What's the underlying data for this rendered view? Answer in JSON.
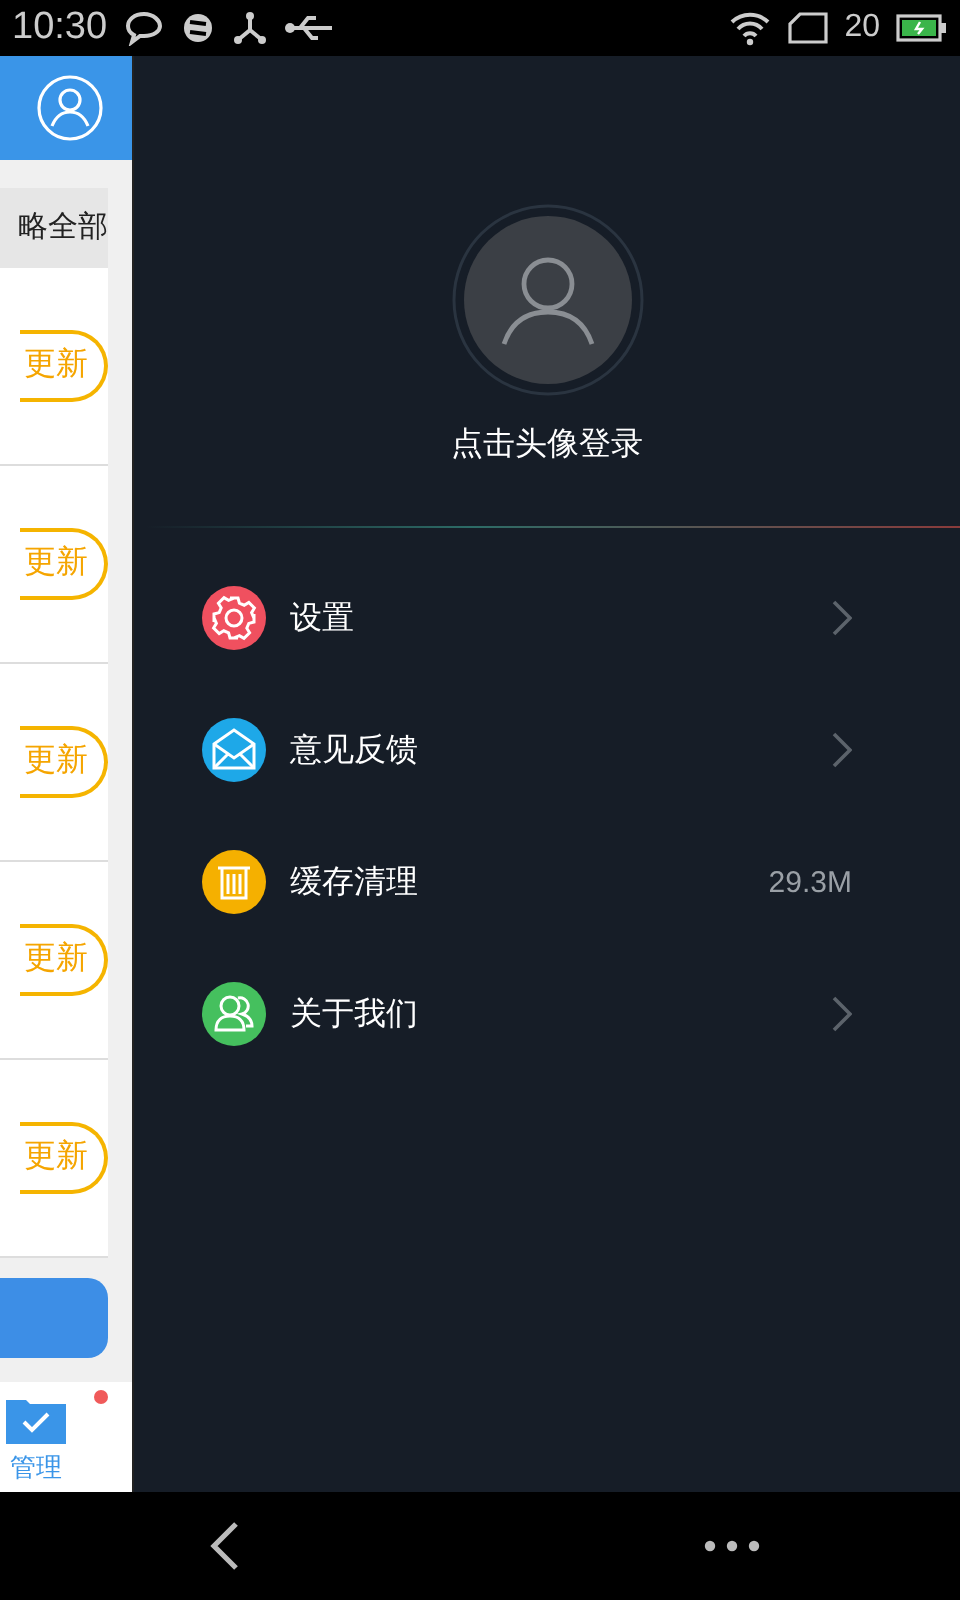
{
  "status_bar": {
    "time": "10:30",
    "battery": "20"
  },
  "background_panel": {
    "filter_label": "略全部",
    "rows": [
      {
        "button": "更新"
      },
      {
        "button": "更新"
      },
      {
        "button": "更新"
      },
      {
        "button": "更新"
      },
      {
        "button": "更新"
      }
    ],
    "tab": {
      "label": "管理",
      "selected": true,
      "badge": true
    }
  },
  "drawer": {
    "login_prompt": "点击头像登录",
    "menu": [
      {
        "color": "#f0505f",
        "label": "设置",
        "kind": "link"
      },
      {
        "color": "#1ea8e8",
        "label": "意见反馈",
        "kind": "link"
      },
      {
        "color": "#f5b000",
        "label": "缓存清理",
        "kind": "value",
        "value": "29.3M"
      },
      {
        "color": "#45c05e",
        "label": "关于我们",
        "kind": "link"
      }
    ]
  }
}
